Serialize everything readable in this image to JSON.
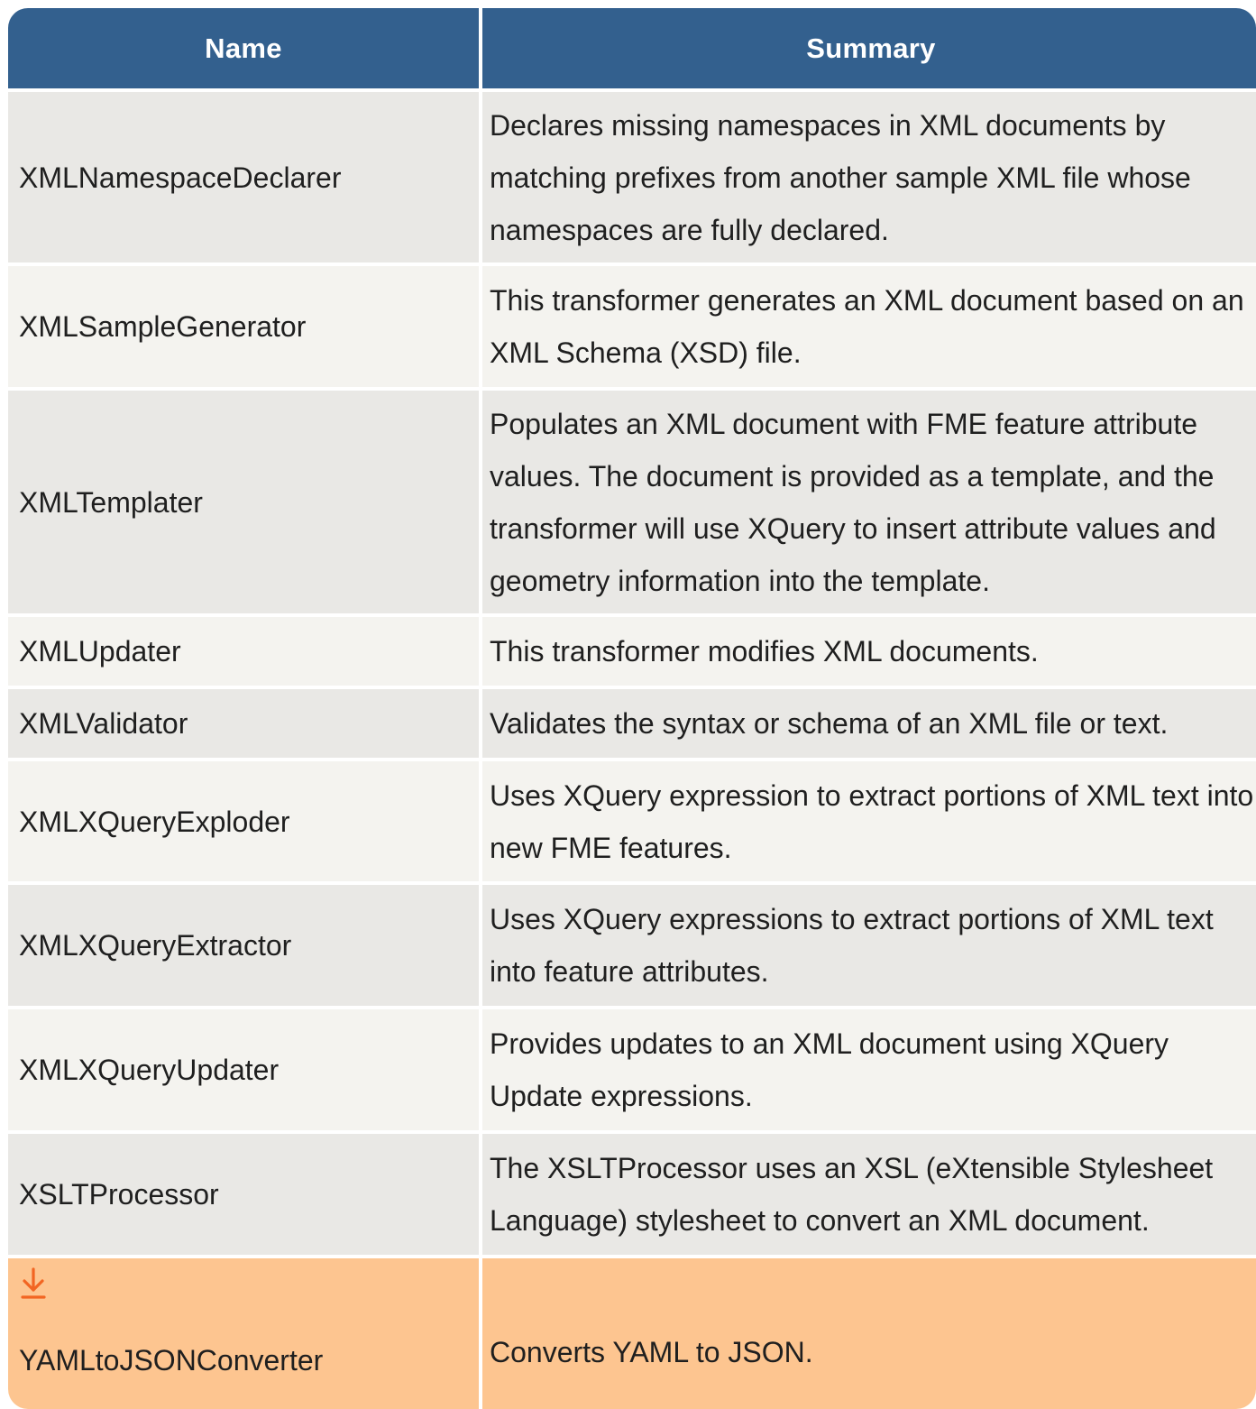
{
  "table": {
    "headers": {
      "name": "Name",
      "summary": "Summary"
    },
    "rows": [
      {
        "name": "XMLNamespaceDeclarer",
        "summary": "Declares missing namespaces in XML documents by matching prefixes from another sample XML file whose namespaces are fully declared."
      },
      {
        "name": "XMLSampleGenerator",
        "summary": "This transformer generates an XML document based on an XML Schema (XSD) file."
      },
      {
        "name": "XMLTemplater",
        "summary": "Populates an XML document with FME feature attribute values. The document is provided as a template, and the transformer will use XQuery to insert attribute values and geometry information into the template."
      },
      {
        "name": "XMLUpdater",
        "summary": "This transformer modifies XML documents."
      },
      {
        "name": "XMLValidator",
        "summary": "Validates the syntax or schema of an XML file or text."
      },
      {
        "name": "XMLXQueryExploder",
        "summary": "Uses XQuery expression to extract portions of XML text into new FME features."
      },
      {
        "name": "XMLXQueryExtractor",
        "summary": "Uses XQuery expressions to extract portions of XML text into feature attributes."
      },
      {
        "name": "XMLXQueryUpdater",
        "summary": "Provides updates to an XML document using XQuery Update expressions."
      },
      {
        "name": "XSLTProcessor",
        "summary": "The XSLTProcessor uses an XSL (eXtensible Stylesheet Language) stylesheet to convert an XML document."
      },
      {
        "name": "YAMLtoJSONConverter",
        "summary": "Converts YAML to JSON.",
        "icon": "download-icon"
      }
    ]
  },
  "colors": {
    "header_bg": "#33608e",
    "header_text": "#ffffff",
    "row_odd": "#e9e8e5",
    "row_even": "#f4f3ef",
    "row_highlight": "#fdc590",
    "icon_accent": "#f26522"
  }
}
